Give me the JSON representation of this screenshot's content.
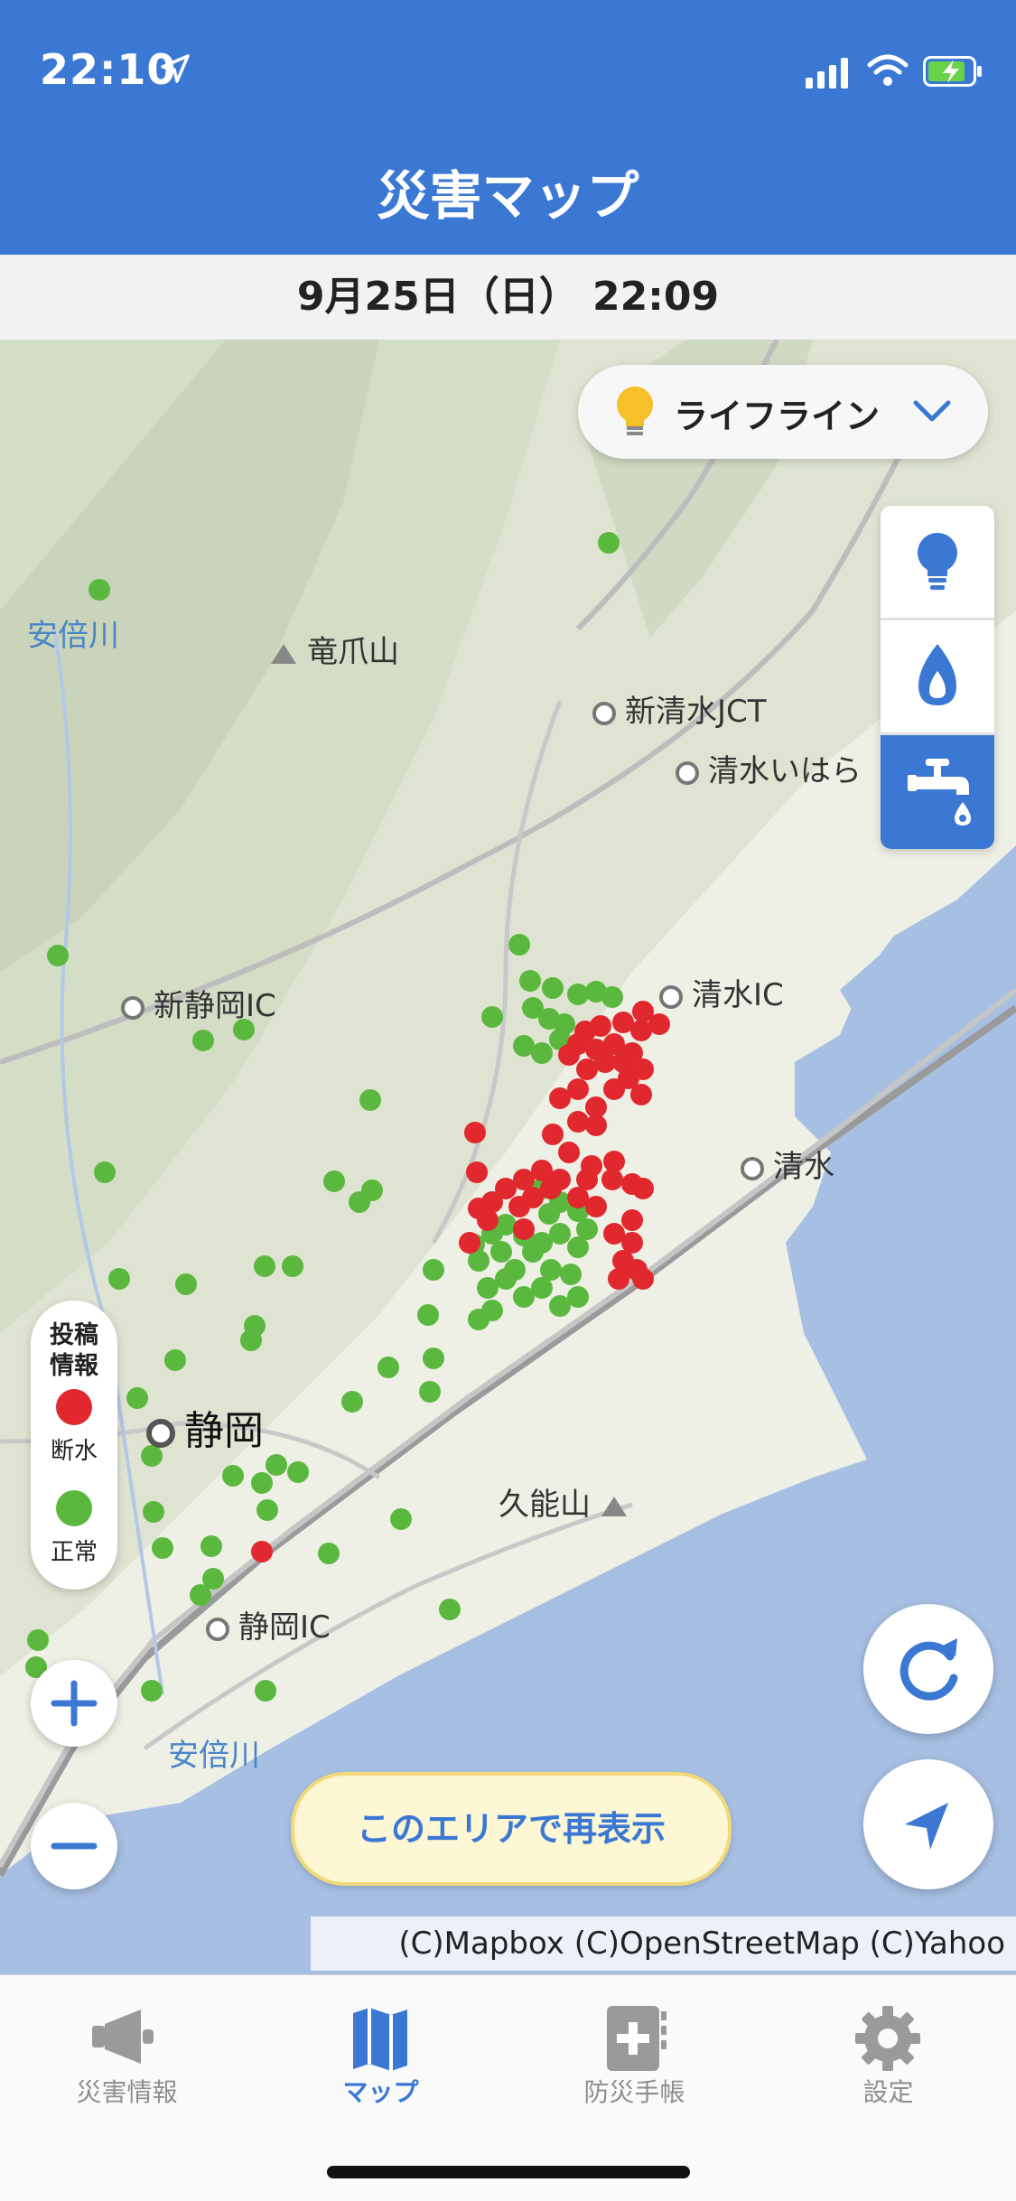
{
  "status_bar": {
    "time": "22:10"
  },
  "header": {
    "title": "災害マップ"
  },
  "date_bar": {
    "text": "9月25日（日） 22:09"
  },
  "map": {
    "places": [
      {
        "key": "ryusozan",
        "label": "竜爪山"
      },
      {
        "key": "shinshimizu_jct",
        "label": "新清水JCT"
      },
      {
        "key": "shimizu_ihara",
        "label": "清水いはら"
      },
      {
        "key": "shimizu_ic",
        "label": "清水IC"
      },
      {
        "key": "shinshizuoka_ic",
        "label": "新静岡IC"
      },
      {
        "key": "shimizu",
        "label": "清水"
      },
      {
        "key": "shizuoka",
        "label": "静岡"
      },
      {
        "key": "kunozan",
        "label": "久能山"
      },
      {
        "key": "shizuoka_ic",
        "label": "静岡IC"
      }
    ],
    "rivers": [
      "安倍川",
      "安倍川"
    ]
  },
  "lifeline_dropdown": {
    "label": "ライフライン",
    "icon": "lightbulb-icon"
  },
  "layer_buttons": [
    {
      "name": "electricity",
      "icon": "lightbulb-icon",
      "selected": false
    },
    {
      "name": "gas",
      "icon": "flame-icon",
      "selected": false
    },
    {
      "name": "water",
      "icon": "faucet-icon",
      "selected": true
    }
  ],
  "legend": {
    "title": "投稿\n情報",
    "items": [
      {
        "label": "断水",
        "color": "#e0282e"
      },
      {
        "label": "正常",
        "color": "#5bb83e"
      }
    ]
  },
  "buttons": {
    "redisplay": "このエリアで再表示"
  },
  "attribution": "(C)Mapbox (C)OpenStreetMap (C)Yahoo Japan",
  "tabs": [
    {
      "label": "災害情報",
      "icon": "megaphone-icon",
      "active": false
    },
    {
      "label": "マップ",
      "icon": "map-icon",
      "active": true
    },
    {
      "label": "防災手帳",
      "icon": "handbook-icon",
      "active": false
    },
    {
      "label": "設定",
      "icon": "gear-icon",
      "active": false
    }
  ],
  "colors": {
    "brand_blue": "#3a78d4",
    "outage_red": "#e0282e",
    "normal_green": "#5bb83e",
    "sea": "#a7bfe3"
  }
}
